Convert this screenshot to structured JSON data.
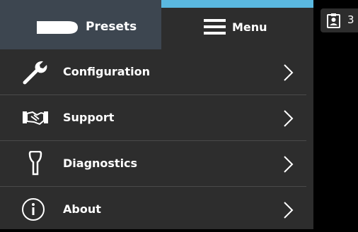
{
  "tabs": {
    "presets": {
      "label": "Presets",
      "icon": "probe-icon"
    },
    "menu": {
      "label": "Menu",
      "icon": "hamburger-menu-icon",
      "accent_color": "#5ab8e0"
    }
  },
  "menu_items": [
    {
      "label": "Configuration",
      "icon": "wrench-icon"
    },
    {
      "label": "Support",
      "icon": "handshake-icon"
    },
    {
      "label": "Diagnostics",
      "icon": "transducer-icon"
    },
    {
      "label": "About",
      "icon": "info-icon"
    }
  ],
  "clipboard_badge": {
    "count": "3",
    "icon": "clipboard-patient-icon"
  },
  "colors": {
    "panel_bg": "#2d2d2d",
    "presets_tab_bg": "#3d4650",
    "accent": "#5ab8e0",
    "text": "#ffffff"
  }
}
